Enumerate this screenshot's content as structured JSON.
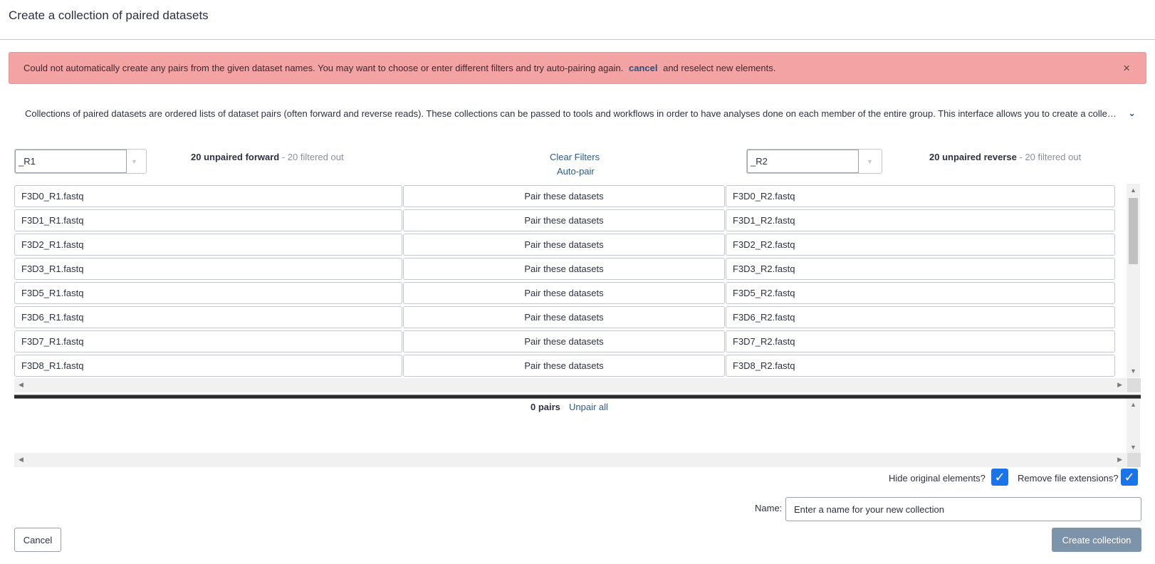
{
  "header": {
    "title": "Create a collection of paired datasets"
  },
  "alert": {
    "text_before": "Could not automatically create any pairs from the given dataset names. You may want to choose or enter different filters and try auto-pairing again.",
    "link": "cancel",
    "text_after": "and reselect new elements.",
    "close": "×"
  },
  "help": {
    "text": "Collections of paired datasets are ordered lists of dataset pairs (often forward and reverse reads). These collections can be passed to tools and workflows in order to have analyses done on each member of the entire group. This interface allows you to create a collection, choose which datasets are paired, and re-order the final collection.",
    "chevron": "⌄"
  },
  "forward_filter": {
    "value": "_R1"
  },
  "reverse_filter": {
    "value": "_R2"
  },
  "forward_count": {
    "bold": "20 unpaired forward",
    "rest": " - 20 filtered out"
  },
  "reverse_count": {
    "bold": "20 unpaired reverse",
    "rest": " - 20 filtered out"
  },
  "middle_links": {
    "clear_filters": "Clear Filters",
    "auto_pair": "Auto-pair"
  },
  "rows": [
    {
      "forward": "F3D0_R1.fastq",
      "pair": "Pair these datasets",
      "reverse": "F3D0_R2.fastq"
    },
    {
      "forward": "F3D1_R1.fastq",
      "pair": "Pair these datasets",
      "reverse": "F3D1_R2.fastq"
    },
    {
      "forward": "F3D2_R1.fastq",
      "pair": "Pair these datasets",
      "reverse": "F3D2_R2.fastq"
    },
    {
      "forward": "F3D3_R1.fastq",
      "pair": "Pair these datasets",
      "reverse": "F3D3_R2.fastq"
    },
    {
      "forward": "F3D5_R1.fastq",
      "pair": "Pair these datasets",
      "reverse": "F3D5_R2.fastq"
    },
    {
      "forward": "F3D6_R1.fastq",
      "pair": "Pair these datasets",
      "reverse": "F3D6_R2.fastq"
    },
    {
      "forward": "F3D7_R1.fastq",
      "pair": "Pair these datasets",
      "reverse": "F3D7_R2.fastq"
    },
    {
      "forward": "F3D8_R1.fastq",
      "pair": "Pair these datasets",
      "reverse": "F3D8_R2.fastq"
    }
  ],
  "paired": {
    "count": "0 pairs",
    "unpair_all": "Unpair all"
  },
  "options": {
    "hide_original": "Hide original elements?",
    "remove_ext": "Remove file extensions?",
    "check": "✓"
  },
  "name": {
    "label": "Name:",
    "placeholder": "Enter a name for your new collection"
  },
  "buttons": {
    "cancel": "Cancel",
    "create": "Create collection"
  },
  "colors": {
    "alert_bg": "#f4a3a5",
    "link": "#2c5b88",
    "checkbox": "#1a73e8",
    "create_btn": "#7d93aa"
  }
}
